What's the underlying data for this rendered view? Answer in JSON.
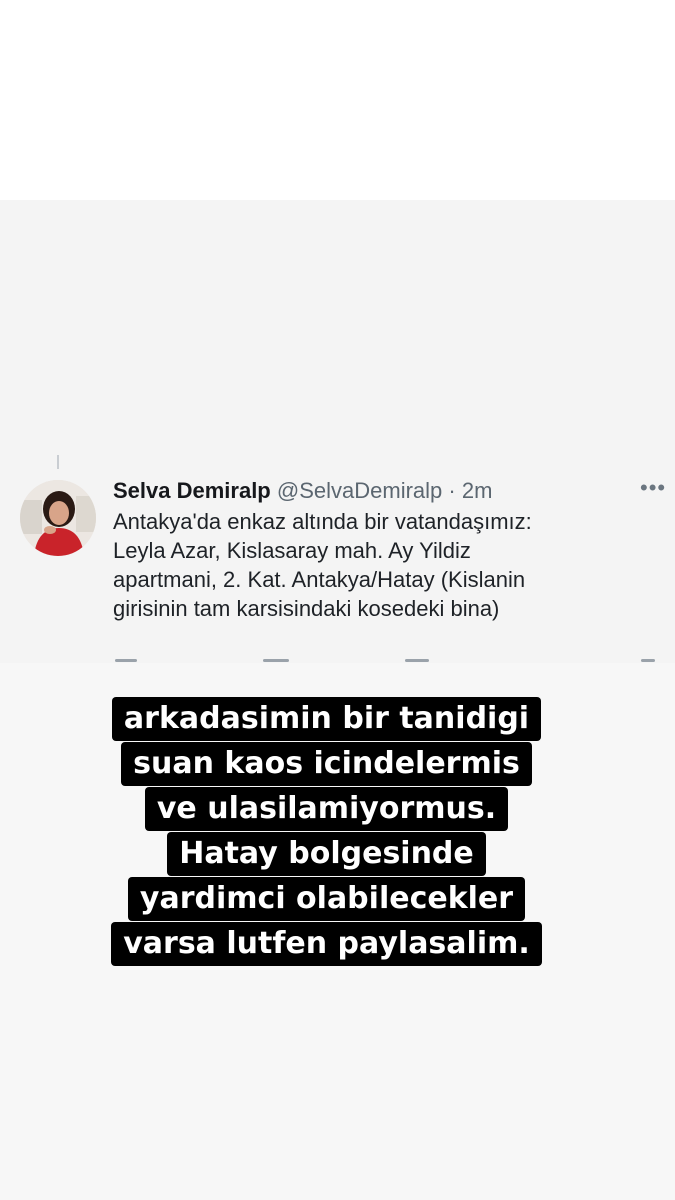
{
  "tweet": {
    "display_name": "Selva Demiralp",
    "handle": "@SelvaDemiralp",
    "separator": "·",
    "time": "2m",
    "more_icon": "more-horizontal-icon",
    "lines": [
      "Antakya'da enkaz altında bir vatandaşımız:",
      "Leyla Azar, Kislasaray mah. Ay Yildiz",
      "apartmani, 2. Kat. Antakya/Hatay (Kislanin",
      "girisinin tam karsisindaki kosedeki bina)"
    ]
  },
  "caption": {
    "lines": [
      "arkadasimin bir tanidigi",
      "suan kaos icindelermis",
      "ve ulasilamiyormus.",
      "Hatay bolgesinde",
      "yardimci olabilecekler",
      "varsa lutfen paylasalim."
    ]
  },
  "colors": {
    "caption_background": "#000000",
    "caption_text": "#ffffff",
    "name_text": "#16181c",
    "secondary_text": "#5b6670"
  }
}
